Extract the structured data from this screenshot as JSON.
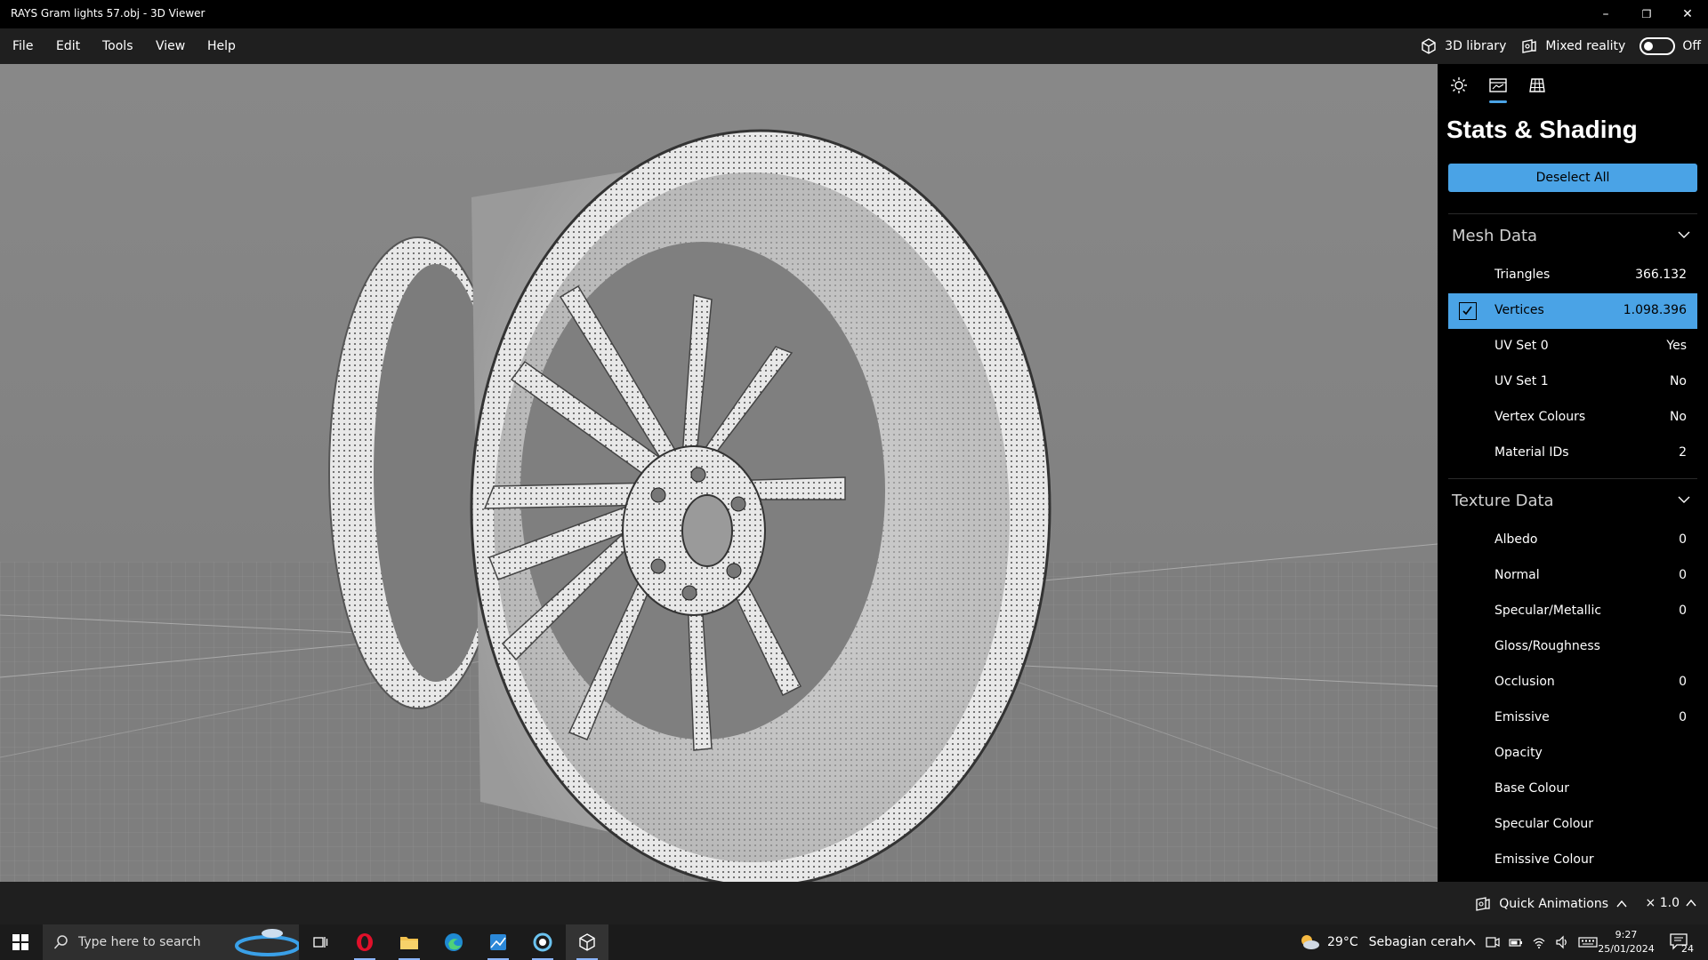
{
  "window": {
    "title": "RAYS Gram lights 57.obj - 3D Viewer",
    "minimize": "–",
    "restore": "❐",
    "close": "✕"
  },
  "menu": {
    "items": [
      "File",
      "Edit",
      "Tools",
      "View",
      "Help"
    ],
    "library_label": "3D library",
    "mixed_reality_label": "Mixed reality",
    "mixed_reality_state": "Off"
  },
  "panel": {
    "tabs": [
      "sun-icon",
      "stats-icon",
      "grid-icon"
    ],
    "title": "Stats & Shading",
    "deselect_label": "Deselect All",
    "mesh_header": "Mesh Data",
    "mesh_rows": [
      {
        "label": "Triangles",
        "value": "366.132",
        "selected": false
      },
      {
        "label": "Vertices",
        "value": "1.098.396",
        "selected": true
      },
      {
        "label": "UV Set 0",
        "value": "Yes",
        "selected": false
      },
      {
        "label": "UV Set 1",
        "value": "No",
        "selected": false
      },
      {
        "label": "Vertex Colours",
        "value": "No",
        "selected": false
      },
      {
        "label": "Material IDs",
        "value": "2",
        "selected": false
      }
    ],
    "texture_header": "Texture Data",
    "texture_rows": [
      {
        "label": "Albedo",
        "value": "0"
      },
      {
        "label": "Normal",
        "value": "0"
      },
      {
        "label": "Specular/Metallic",
        "value": "0"
      },
      {
        "label": "Gloss/Roughness",
        "value": ""
      },
      {
        "label": "Occlusion",
        "value": "0"
      },
      {
        "label": "Emissive",
        "value": "0"
      },
      {
        "label": "Opacity",
        "value": ""
      },
      {
        "label": "Base Colour",
        "value": ""
      },
      {
        "label": "Specular Colour",
        "value": ""
      },
      {
        "label": "Emissive Colour",
        "value": ""
      }
    ]
  },
  "statusbar": {
    "animations_label": "Quick Animations",
    "speed": "× 1.0"
  },
  "taskbar": {
    "search_placeholder": "Type here to search",
    "weather_temp": "29°C",
    "weather_desc": "Sebagian cerah",
    "time": "9:27",
    "date": "25/01/2024",
    "notifications": "24"
  },
  "colors": {
    "accent": "#4aa3e6",
    "panel_bg": "#000000",
    "viewport_bg": "#858585"
  }
}
